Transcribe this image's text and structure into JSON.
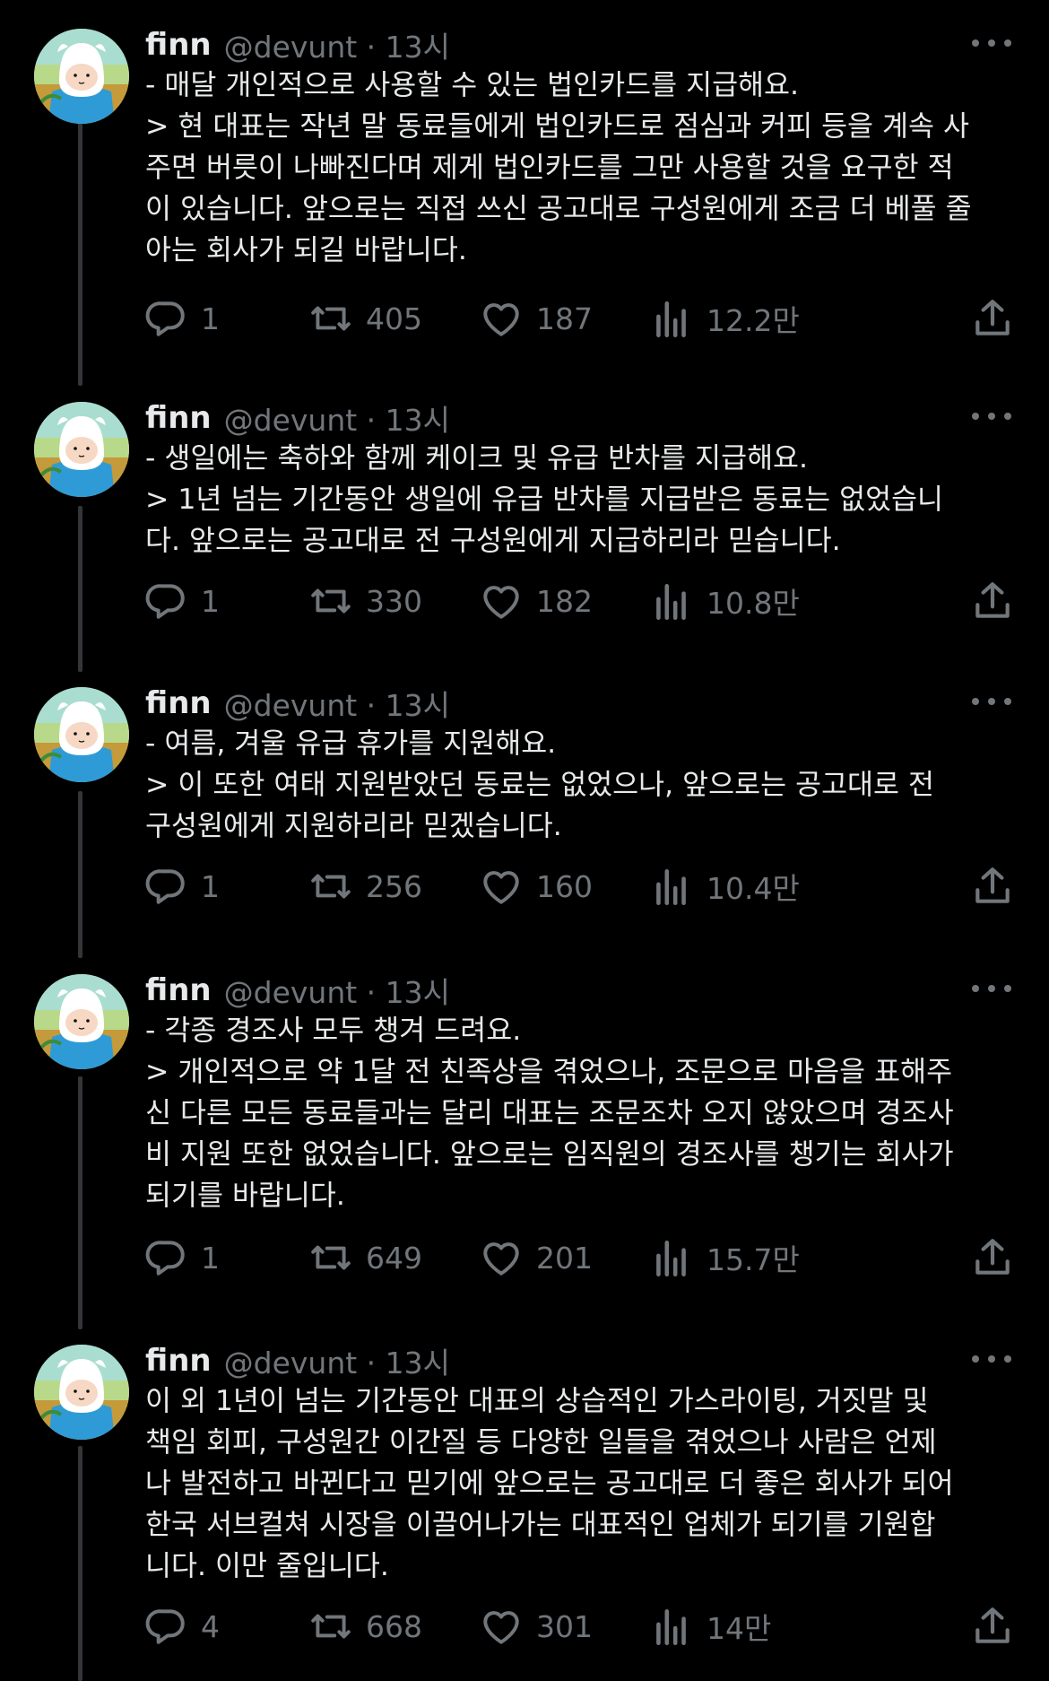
{
  "tweets": [
    {
      "name": "finn",
      "handle": "@devunt · 13시",
      "lines": [
        "- 매달 개인적으로 사용할 수 있는 법인카드를 지급해요.",
        "> 현 대표는 작년 말 동료들에게 법인카드로 점심과 커피 등을 계속 사",
        "주면 버릇이 나빠진다며 제게 법인카드를 그만 사용할 것을 요구한 적",
        "이 있습니다. 앞으로는 직접 쓰신 공고대로 구성원에게 조금 더 베풀 줄",
        "아는 회사가 되길 바랍니다."
      ],
      "replies": "1",
      "retweets": "405",
      "likes": "187",
      "views": "12.2만"
    },
    {
      "name": "finn",
      "handle": "@devunt · 13시",
      "lines": [
        "- 생일에는 축하와 함께 케이크 및 유급 반차를 지급해요.",
        "> 1년 넘는 기간동안 생일에 유급 반차를 지급받은 동료는 없었습니",
        "다. 앞으로는 공고대로 전 구성원에게 지급하리라 믿습니다."
      ],
      "replies": "1",
      "retweets": "330",
      "likes": "182",
      "views": "10.8만"
    },
    {
      "name": "finn",
      "handle": "@devunt · 13시",
      "lines": [
        "- 여름, 겨울 유급 휴가를 지원해요.",
        "> 이 또한 여태 지원받았던 동료는 없었으나, 앞으로는 공고대로 전",
        "구성원에게 지원하리라 믿겠습니다."
      ],
      "replies": "1",
      "retweets": "256",
      "likes": "160",
      "views": "10.4만"
    },
    {
      "name": "finn",
      "handle": "@devunt · 13시",
      "lines": [
        "- 각종 경조사 모두 챙겨 드려요.",
        "> 개인적으로 약 1달 전 친족상을 겪었으나, 조문으로 마음을 표해주",
        "신 다른 모든 동료들과는 달리 대표는 조문조차 오지 않았으며 경조사",
        "비 지원 또한 없었습니다. 앞으로는 임직원의 경조사를 챙기는 회사가",
        "되기를 바랍니다."
      ],
      "replies": "1",
      "retweets": "649",
      "likes": "201",
      "views": "15.7만"
    },
    {
      "name": "finn",
      "handle": "@devunt · 13시",
      "lines": [
        "이 외 1년이 넘는 기간동안 대표의 상습적인 가스라이팅, 거짓말 및",
        "책임 회피, 구성원간 이간질 등 다양한 일들을 겪었으나 사람은 언제",
        "나 발전하고 바뀐다고 믿기에 앞으로는 공고대로 더 좋은 회사가 되어",
        "한국 서브컬쳐 시장을 이끌어나가는 대표적인 업체가 되기를 기원합",
        "니다. 이만 줄입니다."
      ],
      "replies": "4",
      "retweets": "668",
      "likes": "301",
      "views": "14만"
    }
  ],
  "icons": {
    "reply": "reply-icon",
    "retweet": "retweet-icon",
    "like": "heart-icon",
    "views": "views-icon",
    "share": "share-icon",
    "more": "more-icon"
  },
  "colors": {
    "background": "#000000",
    "text": "#e7e9ea",
    "muted": "#71767b",
    "thread_line": "#333639"
  }
}
